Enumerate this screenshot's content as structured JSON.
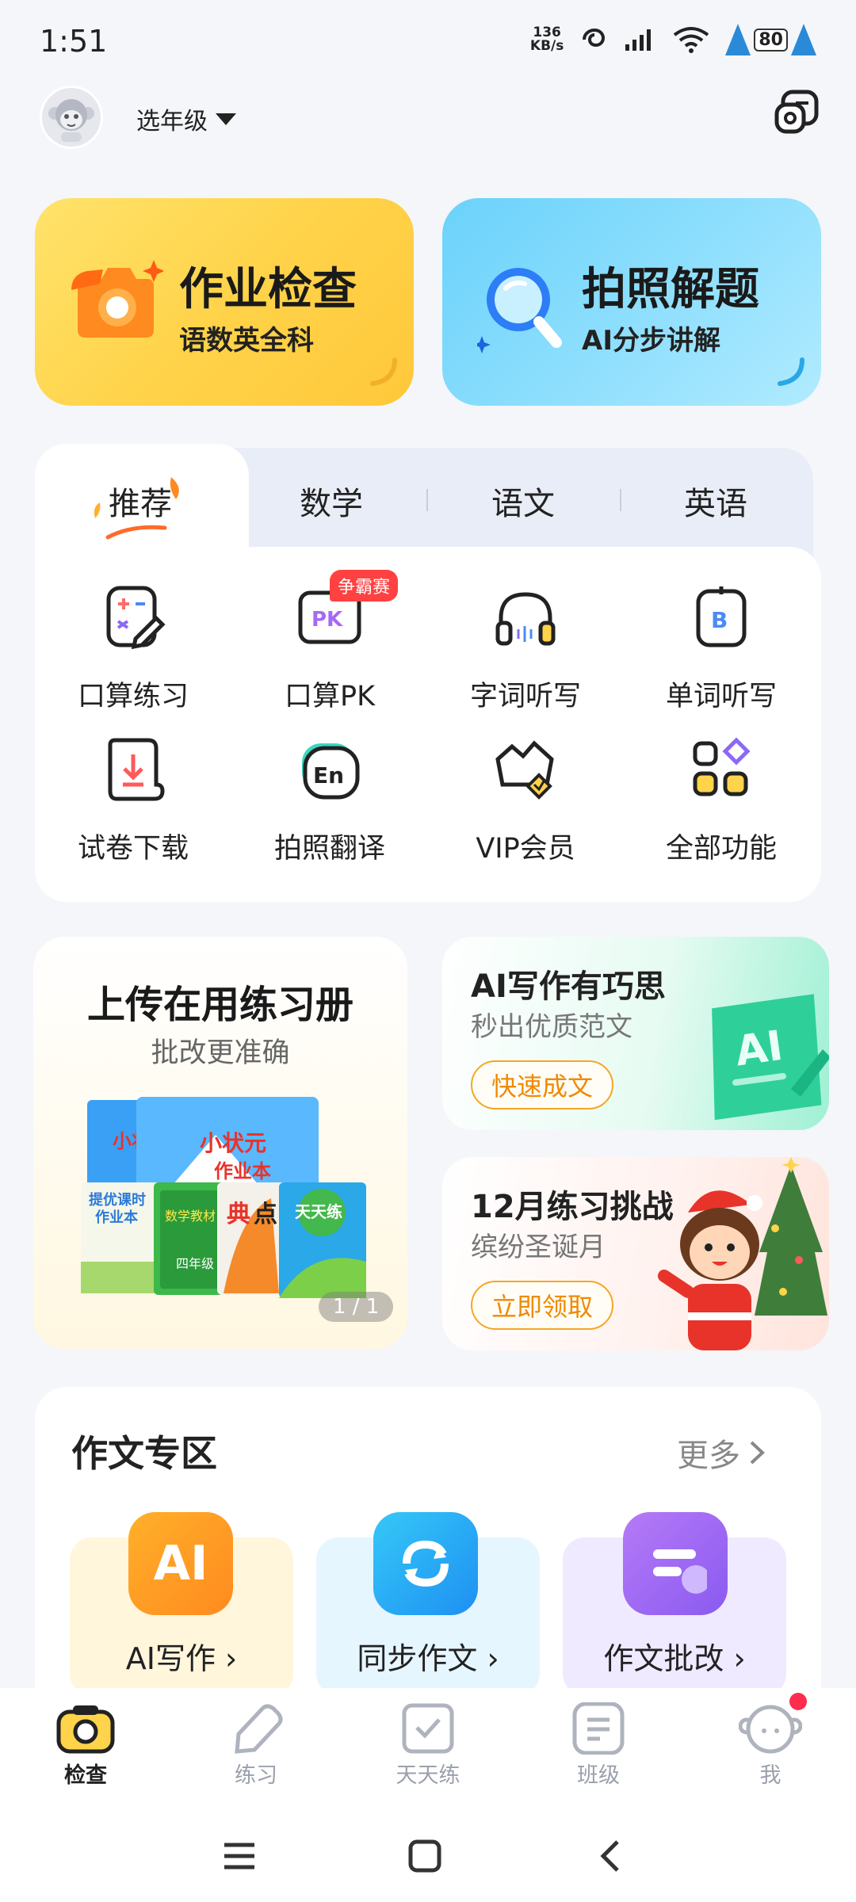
{
  "status": {
    "time": "1:51",
    "net_speed_value": "136",
    "net_speed_unit": "KB/s",
    "battery": "80"
  },
  "header": {
    "grade_label": "选年级"
  },
  "quick_cards": {
    "homework_check": {
      "title": "作业检查",
      "subtitle": "语数英全科"
    },
    "photo_solve": {
      "title": "拍照解题",
      "subtitle": "AI分步讲解"
    }
  },
  "tabs": [
    "推荐",
    "数学",
    "语文",
    "英语"
  ],
  "features": [
    {
      "label": "口算练习",
      "icon": "calculation-icon"
    },
    {
      "label": "口算PK",
      "icon": "pk-icon",
      "badge": "争霸赛"
    },
    {
      "label": "字词听写",
      "icon": "headphones-icon"
    },
    {
      "label": "单词听写",
      "icon": "word-dictation-icon"
    },
    {
      "label": "试卷下载",
      "icon": "download-paper-icon"
    },
    {
      "label": "拍照翻译",
      "icon": "photo-translate-icon"
    },
    {
      "label": "VIP会员",
      "icon": "vip-icon"
    },
    {
      "label": "全部功能",
      "icon": "all-functions-icon"
    }
  ],
  "promos": {
    "workbook": {
      "title": "上传在用练习册",
      "subtitle": "批改更准确",
      "page_indicator": "1 / 1",
      "book_text": {
        "b1": "小状元",
        "b2": "小状元",
        "b2_sub": "作业本",
        "b3": "提优课时",
        "b3_sub": "作业本",
        "b4": "数学教材",
        "b4_sub": "四年级",
        "b5": "典",
        "b5_b": "点",
        "b6": "天天练"
      }
    },
    "ai_writing": {
      "title": "AI写作有巧思",
      "subtitle": "秒出优质范文",
      "button": "快速成文",
      "art_text": "AI"
    },
    "challenge": {
      "title": "12月练习挑战",
      "subtitle": "缤纷圣诞月",
      "button": "立即领取"
    }
  },
  "essay": {
    "title": "作文专区",
    "more": "更多",
    "items": [
      {
        "label": "AI写作 ›",
        "icon_text": "AI"
      },
      {
        "label": "同步作文 ›"
      },
      {
        "label": "作文批改 ›"
      }
    ]
  },
  "bottom_nav": [
    {
      "label": "检查",
      "active": true
    },
    {
      "label": "练习"
    },
    {
      "label": "天天练"
    },
    {
      "label": "班级"
    },
    {
      "label": "我"
    }
  ],
  "colors": {
    "accent_orange": "#f08a00",
    "check_yellow": "#ffd34a",
    "photo_blue": "#6bd2fb",
    "notif_red": "#ff2d4d"
  }
}
